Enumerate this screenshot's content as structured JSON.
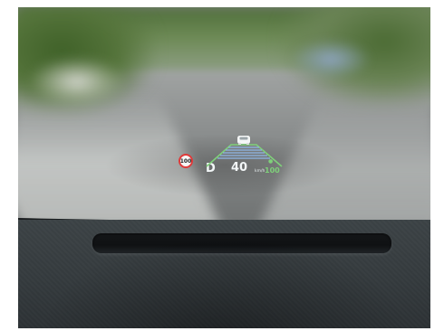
{
  "hud": {
    "speed_limit": "100",
    "gear": "D",
    "speed": "40",
    "speed_unit": "km/h",
    "set_speed": "100",
    "colors": {
      "speed_limit_ring": "#e03a3a",
      "lane_lines": "#7fd07a",
      "lane_bands": "#8fb7e8",
      "text": "#f2f6f7"
    },
    "icons": [
      "speed-limit-sign-icon",
      "lead-car-icon",
      "lane-guidance-icon",
      "cruise-control-icon"
    ]
  }
}
